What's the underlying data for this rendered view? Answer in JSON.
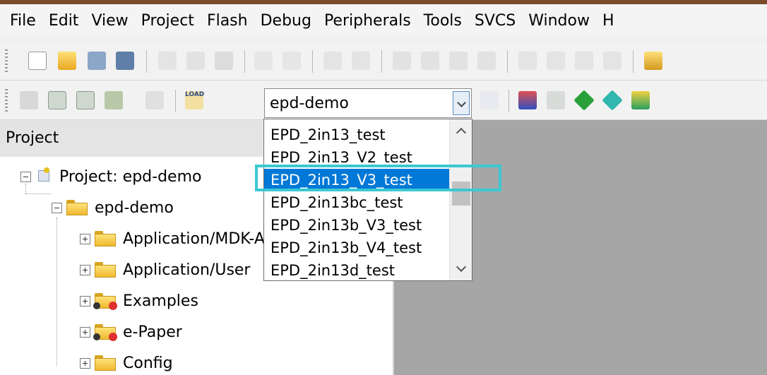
{
  "menubar": {
    "items": [
      "File",
      "Edit",
      "View",
      "Project",
      "Flash",
      "Debug",
      "Peripherals",
      "Tools",
      "SVCS",
      "Window",
      "H"
    ]
  },
  "toolbar": {
    "target_select": {
      "value": "epd-demo"
    },
    "load_label": "LOAD"
  },
  "project_panel": {
    "title": "Project",
    "tree": [
      {
        "label": "Project: epd-demo",
        "expander": "minus"
      },
      {
        "label": "epd-demo",
        "expander": "minus"
      },
      {
        "label": "Application/MDK-ARM",
        "expander": "plus"
      },
      {
        "label": "Application/User",
        "expander": "plus"
      },
      {
        "label": "Examples",
        "expander": "plus"
      },
      {
        "label": "e-Paper",
        "expander": "plus"
      },
      {
        "label": "Config",
        "expander": "plus"
      }
    ]
  },
  "dropdown": {
    "items": [
      "EPD_2in13_test",
      "EPD_2in13_V2_test",
      "EPD_2in13_V3_test",
      "EPD_2in13bc_test",
      "EPD_2in13b_V3_test",
      "EPD_2in13b_V4_test",
      "EPD_2in13d_test"
    ],
    "selected": "EPD_2in13_V3_test"
  },
  "colors": {
    "selection": "#0078d7",
    "highlight_box": "#3cc8d2",
    "editor_background": "#a6a6a6"
  }
}
